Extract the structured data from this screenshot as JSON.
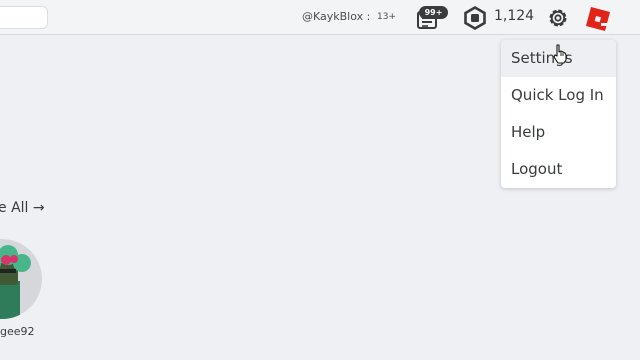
{
  "header": {
    "username": "@KaykBlox :",
    "age_label": "13+",
    "notification_badge": "99+",
    "robux_amount": "1,124"
  },
  "settings_menu": {
    "items": [
      {
        "label": "Settings"
      },
      {
        "label": "Quick Log In"
      },
      {
        "label": "Help"
      },
      {
        "label": "Logout"
      }
    ]
  },
  "main": {
    "see_all_label": "e All →",
    "friend_name": "gee92"
  },
  "icons": {
    "notifications": "notifications-icon",
    "robux": "robux-icon",
    "settings": "gear-icon",
    "logo": "roblox-logo-icon",
    "cursor": "hand-cursor-icon"
  },
  "colors": {
    "background": "#eff0f4",
    "logo_red": "#e2231a",
    "hover": "#eeeff2"
  }
}
